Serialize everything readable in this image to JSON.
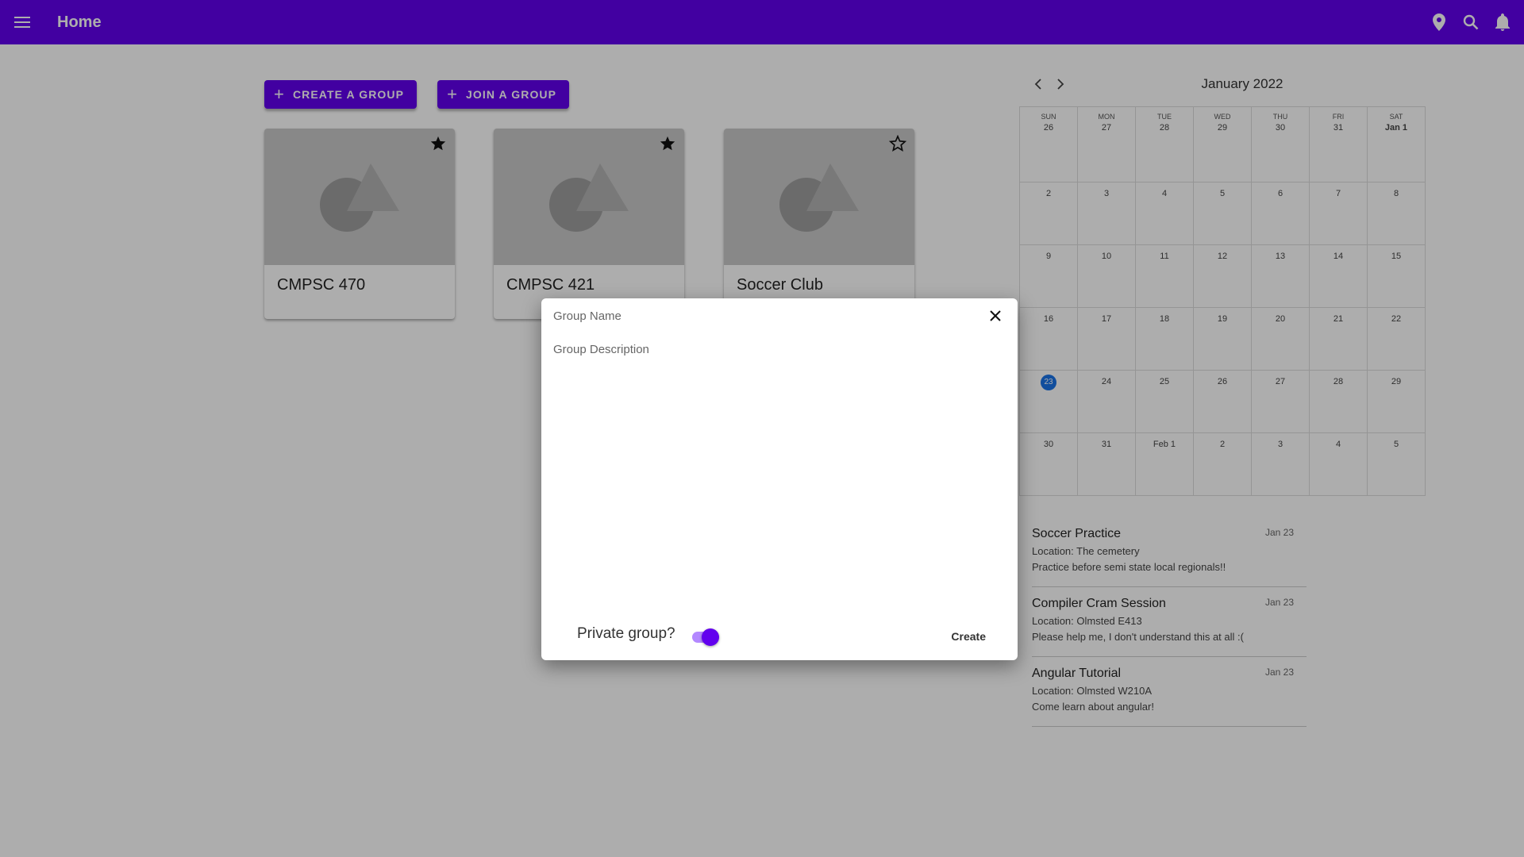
{
  "appbar": {
    "title": "Home",
    "icons": [
      "menu-icon",
      "location-pin-icon",
      "search-icon",
      "bell-icon"
    ],
    "color": "#6200ee"
  },
  "actions": {
    "create_label": "CREATE A GROUP",
    "join_label": "JOIN A GROUP"
  },
  "groups": [
    {
      "name": "CMPSC 470",
      "starred": true
    },
    {
      "name": "CMPSC 421",
      "starred": true
    },
    {
      "name": "Soccer Club",
      "starred": false
    }
  ],
  "calendar": {
    "month_label": "January 2022",
    "weekdays": [
      "SUN",
      "MON",
      "TUE",
      "WED",
      "THU",
      "FRI",
      "SAT"
    ],
    "weeks": [
      [
        "26",
        "27",
        "28",
        "29",
        "30",
        "31",
        "Jan 1"
      ],
      [
        "2",
        "3",
        "4",
        "5",
        "6",
        "7",
        "8"
      ],
      [
        "9",
        "10",
        "11",
        "12",
        "13",
        "14",
        "15"
      ],
      [
        "16",
        "17",
        "18",
        "19",
        "20",
        "21",
        "22"
      ],
      [
        "23",
        "24",
        "25",
        "26",
        "27",
        "28",
        "29"
      ],
      [
        "30",
        "31",
        "Feb 1",
        "2",
        "3",
        "4",
        "5"
      ]
    ],
    "today": "23",
    "today_color": "#1a73e8"
  },
  "events": [
    {
      "title": "Soccer Practice",
      "date": "Jan 23",
      "location": "Location: The cemetery",
      "description": "Practice before semi state local regionals!!"
    },
    {
      "title": "Compiler Cram Session",
      "date": "Jan 23",
      "location": "Location: Olmsted E413",
      "description": "Please help me, I don't understand this at all :("
    },
    {
      "title": "Angular Tutorial",
      "date": "Jan 23",
      "location": "Location: Olmsted W210A",
      "description": "Come learn about angular!"
    }
  ],
  "dialog": {
    "name_placeholder": "Group Name",
    "description_placeholder": "Group Description",
    "private_label": "Private group?",
    "private_enabled": true,
    "create_label": "Create"
  }
}
